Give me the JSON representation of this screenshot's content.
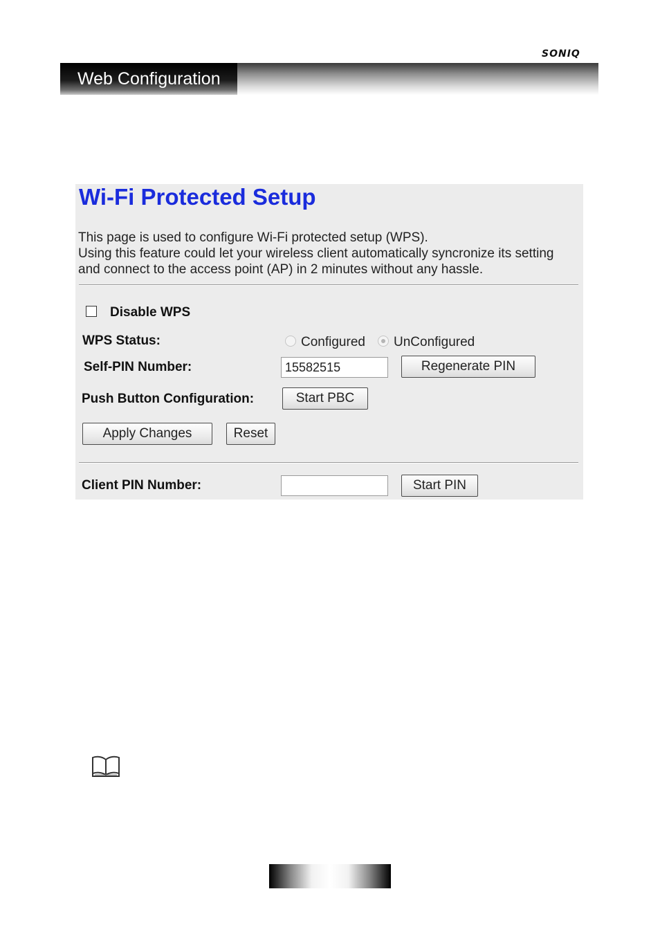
{
  "header": {
    "brand": "SONIQ",
    "title": "Web Configuration"
  },
  "wps": {
    "title": "Wi-Fi Protected Setup",
    "description": [
      "This page is used to configure Wi-Fi protected setup (WPS).",
      "Using this feature could let your wireless client automatically syncronize its setting",
      "and connect to the access point (AP) in 2 minutes without any hassle."
    ],
    "disable_wps_label": "Disable WPS",
    "disable_wps_checked": false,
    "status_label": "WPS Status:",
    "status_options": [
      "Configured",
      "UnConfigured"
    ],
    "status_selected": "UnConfigured",
    "self_pin_label": "Self-PIN Number:",
    "self_pin_value": "15582515",
    "regenerate_pin_label": "Regenerate PIN",
    "pbc_label": "Push Button Configuration:",
    "start_pbc_label": "Start PBC",
    "apply_label": "Apply Changes",
    "reset_label": "Reset",
    "client_pin_label": "Client PIN Number:",
    "client_pin_value": "",
    "start_pin_label": "Start PIN"
  },
  "icons": {
    "note": "book-icon"
  }
}
